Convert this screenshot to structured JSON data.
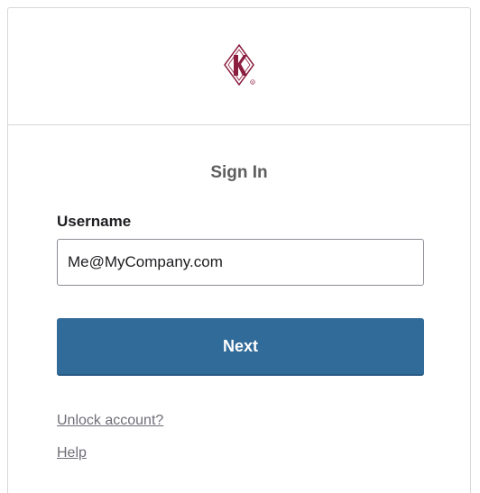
{
  "header": {
    "logo_icon": "diamond-k-logo-icon",
    "brand_color": "#8b1e3f"
  },
  "form": {
    "title": "Sign In",
    "username_label": "Username",
    "username_value": "Me@MyCompany.com",
    "next_label": "Next",
    "button_color": "#316b99"
  },
  "links": {
    "unlock": "Unlock account?",
    "help": "Help"
  }
}
